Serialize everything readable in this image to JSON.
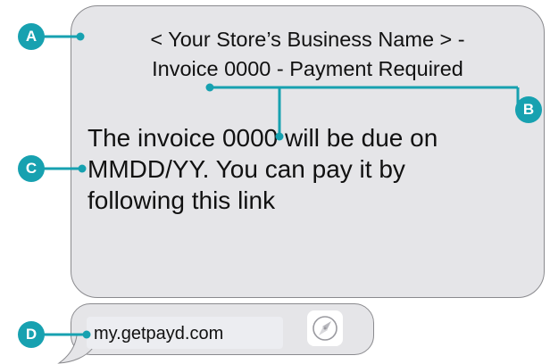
{
  "subject": {
    "line1": "< Your Store’s Business Name > -",
    "line2": "Invoice 0000  - Payment Required"
  },
  "message": {
    "line1": "The invoice 0000 will be due on",
    "line2": "MMDD/YY. You can pay it by",
    "line3": "following this link"
  },
  "link": {
    "text": "my.getpayd.com",
    "icon": "compass-icon"
  },
  "callouts": {
    "a": "A",
    "b": "B",
    "c": "C",
    "d": "D"
  },
  "colors": {
    "callout": "#17a1b0",
    "bubble_fill": "#e5e5e8",
    "bubble_border": "#8a8a8e",
    "text": "#111111"
  }
}
